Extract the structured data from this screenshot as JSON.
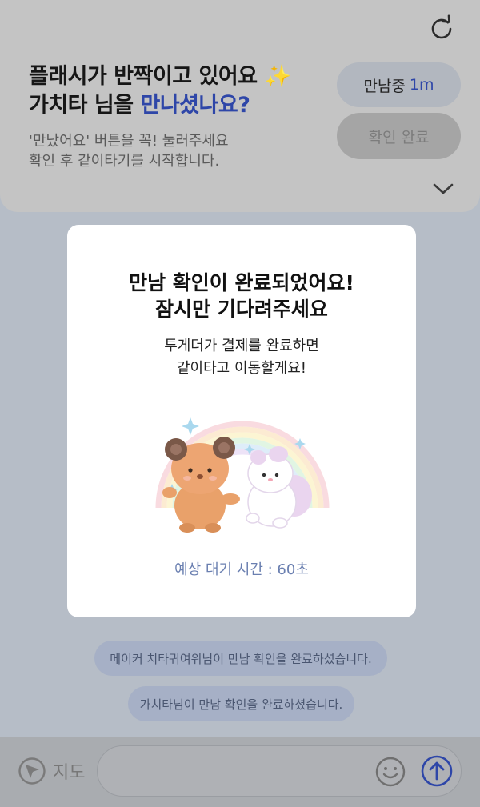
{
  "header": {
    "title_line1": "플래시가 반짝이고 있어요 ",
    "title_sparkle": "✨",
    "title_line2_prefix": "가치타 님을 ",
    "title_line2_accent": "만나셨나요?",
    "sub_line1": "'만났어요' 버튼을 꼭! 눌러주세요",
    "sub_line2": "확인 후 같이타기를 시작합니다.",
    "meeting_label": "만남중",
    "meeting_duration": "1m",
    "confirm_label": "확인 완료"
  },
  "modal": {
    "title_line1": "만남 확인이 완료되었어요!",
    "title_line2": "잠시만 기다려주세요",
    "desc_line1": "투게더가 결제를 완료하면",
    "desc_line2": "같이타고 이동할게요!",
    "wait_time": "예상 대기 시간 : 60초"
  },
  "messages": [
    "메이커 치타귀여워님이 만남 확인을 완료하셨습니다.",
    "가치타님이 만남 확인을 완료하셨습니다."
  ],
  "bottom": {
    "map_label": "지도"
  },
  "colors": {
    "accent": "#2e46a8",
    "wait_text": "#6a7fb0"
  }
}
